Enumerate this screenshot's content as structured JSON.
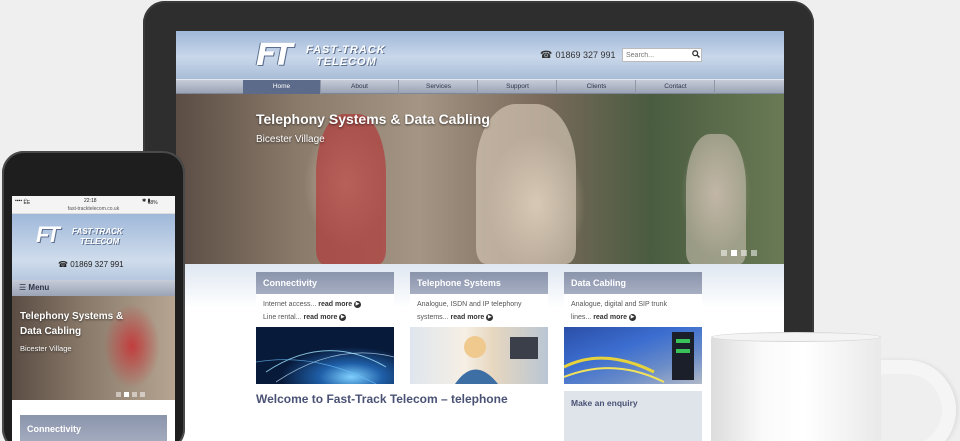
{
  "site": {
    "logo_initials": "FT",
    "logo_line1": "FAST-TRACK",
    "logo_line2": "TELECOM",
    "phone": "01869 327 991",
    "search_placeholder": "Search...",
    "nav": [
      "Home",
      "About",
      "Services",
      "Support",
      "Clients",
      "Contact"
    ],
    "nav_active": "Home"
  },
  "hero": {
    "title": "Telephony Systems & Data Cabling",
    "subtitle": "Bicester Village",
    "slides": 4,
    "active_slide": 2
  },
  "cards": [
    {
      "title": "Connectivity",
      "line1": "Internet access...",
      "line2": "Line rental...",
      "more": "read more"
    },
    {
      "title": "Telephone Systems",
      "line1": "Analogue, ISDN and IP telephony",
      "line2": "systems...",
      "more": "read more"
    },
    {
      "title": "Data Cabling",
      "line1": "Analogue, digital and SIP trunk",
      "line2": "lines...",
      "more": "read more"
    }
  ],
  "welcome": "Welcome to Fast-Track Telecom – telephone",
  "enquiry": "Make an enquiry",
  "mobile": {
    "carrier": "EE",
    "time": "22:18",
    "battery": "68%",
    "url": "fast-tracktelecom.co.uk",
    "menu": "Menu",
    "hero_title": "Telephony Systems & Data Cabling",
    "hero_subtitle": "Bicester Village",
    "card_title": "Connectivity"
  },
  "colors": {
    "accent": "#5c6b8a",
    "card_header": "#8a94ab",
    "heading": "#4a5275"
  }
}
